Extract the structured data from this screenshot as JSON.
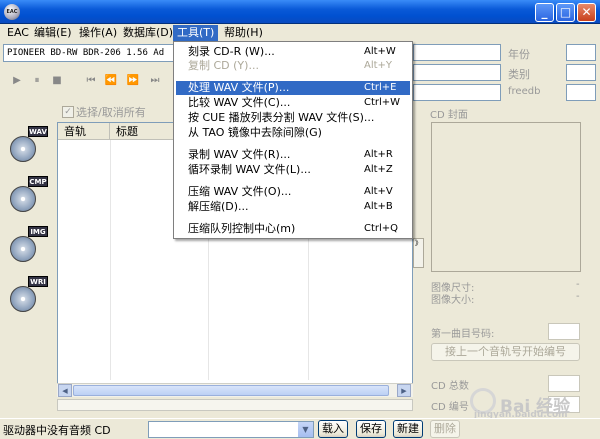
{
  "titlebar": {
    "app_icon_text": "EAC",
    "minimize_glyph": "_",
    "maximize_glyph": "□",
    "close_glyph": "✕"
  },
  "menubar": {
    "items": [
      {
        "label": "EAC"
      },
      {
        "label": "编辑(E)"
      },
      {
        "label": "操作(A)"
      },
      {
        "label": "数据库(D)"
      },
      {
        "label": "工具(T)"
      },
      {
        "label": "帮助(H)"
      }
    ]
  },
  "toolbar": {
    "drive_text": "PIONEER BD-RW   BDR-206 1.56  Ad",
    "buttons": [
      "▶",
      "⏸",
      "■",
      "⏮",
      "⏪",
      "⏩",
      "⏭"
    ]
  },
  "select_all_label": "选择/取消所有",
  "select_all_check": "✓",
  "side_buttons": [
    {
      "tag": "WAV"
    },
    {
      "tag": "CMP"
    },
    {
      "tag": "IMG"
    },
    {
      "tag": "WRI"
    }
  ],
  "track_list": {
    "headers": [
      "音轨",
      "标题"
    ]
  },
  "scroll_glyphs": {
    "left": "◀",
    "right": "▶"
  },
  "toggle_glyph": "》",
  "right_panel": {
    "year_label": "年份",
    "genre_label": "类别",
    "freedb_label": "freedb",
    "cover_label": "CD 封面",
    "image_size_label": "图像尺寸:",
    "image_size_value": "-",
    "image_bytes_label": "图像大小:",
    "image_bytes_value": "-",
    "first_track_label": "第一曲目号码:",
    "continue_button": "接上一个音轨号开始编号",
    "cd_total_label": "CD 总数",
    "cd_number_label": "CD 编号"
  },
  "statusbar": {
    "status_text": "驱动器中没有音频 CD",
    "combo_arrow": "▼",
    "buttons": [
      {
        "label": "载入",
        "disabled": false
      },
      {
        "label": "保存",
        "disabled": false
      },
      {
        "label": "新建",
        "disabled": false
      },
      {
        "label": "删除",
        "disabled": true
      }
    ]
  },
  "tools_menu": {
    "items": [
      {
        "label": "刻录 CD-R (W)...",
        "shortcut": "Alt+W",
        "state": "normal"
      },
      {
        "label": "复制 CD (Y)...",
        "shortcut": "Alt+Y",
        "state": "disabled"
      },
      {
        "label": "处理 WAV 文件(P)...",
        "shortcut": "Ctrl+E",
        "state": "highlighted"
      },
      {
        "label": "比较 WAV 文件(C)...",
        "shortcut": "Ctrl+W",
        "state": "normal"
      },
      {
        "label": "按 CUE 播放列表分割 WAV 文件(S)...",
        "shortcut": "",
        "state": "normal"
      },
      {
        "label": "从 TAO 镜像中去除间隙(G)",
        "shortcut": "",
        "state": "normal"
      },
      {
        "label": "录制 WAV 文件(R)...",
        "shortcut": "Alt+R",
        "state": "normal"
      },
      {
        "label": "循环录制 WAV 文件(L)...",
        "shortcut": "Alt+Z",
        "state": "normal"
      },
      {
        "label": "压缩 WAV 文件(O)...",
        "shortcut": "Alt+V",
        "state": "normal"
      },
      {
        "label": "解压缩(D)...",
        "shortcut": "Alt+B",
        "state": "normal"
      },
      {
        "label": "压缩队列控制中心(m)",
        "shortcut": "Ctrl+Q",
        "state": "normal"
      }
    ]
  },
  "watermark": {
    "text": "Bai 经验",
    "url": "jingyan.baidu.com"
  }
}
